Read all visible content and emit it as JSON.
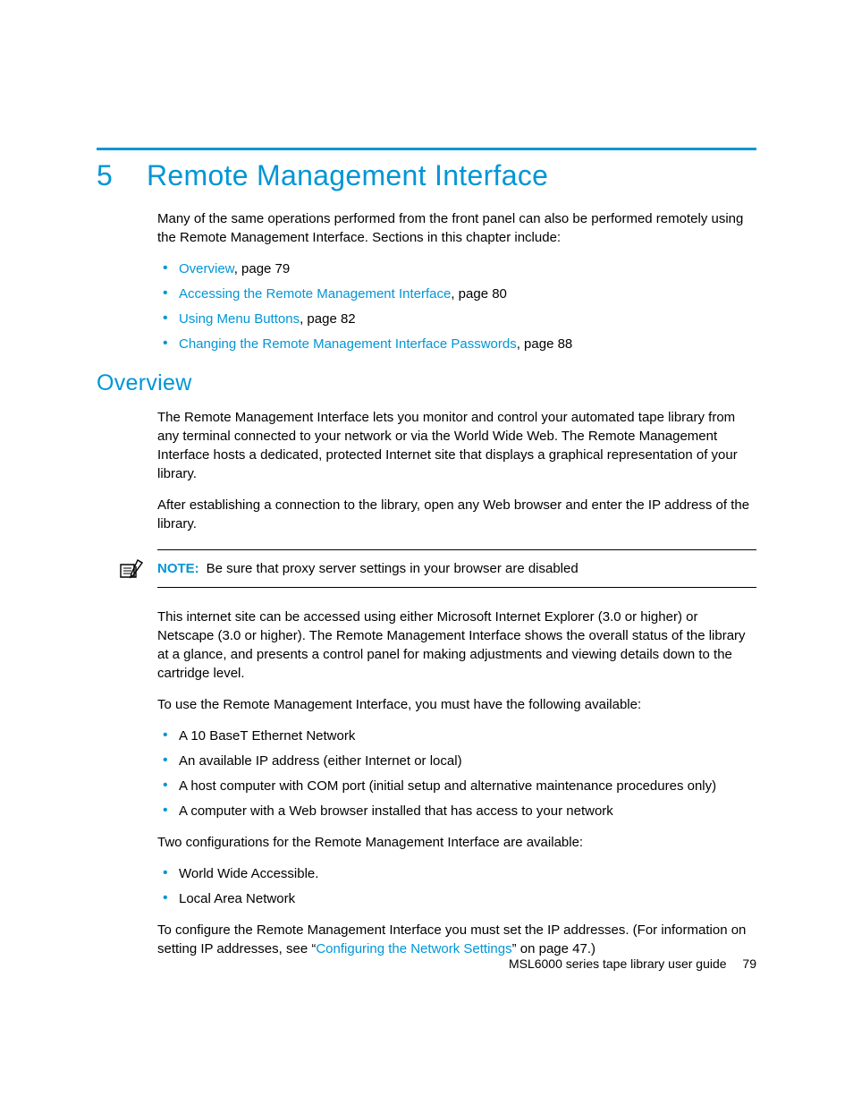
{
  "chapter": {
    "number": "5",
    "title": "Remote Management Interface"
  },
  "intro": "Many of the same operations performed from the front panel can also be performed remotely using the Remote Management Interface. Sections in this chapter include:",
  "toc": [
    {
      "link": "Overview",
      "suffix": ", page 79"
    },
    {
      "link": "Accessing the Remote Management Interface",
      "suffix": ", page 80"
    },
    {
      "link": "Using Menu Buttons",
      "suffix": ", page 82"
    },
    {
      "link": "Changing the Remote Management Interface Passwords",
      "suffix": ", page 88"
    }
  ],
  "section": {
    "heading": "Overview",
    "p1": "The Remote Management Interface lets you monitor and control your automated tape library from any terminal connected to your network or via the World Wide Web. The Remote Management Interface hosts a dedicated, protected Internet site that displays a graphical representation of your library.",
    "p2": "After establishing a connection to the library, open any Web browser and enter the IP address of the library.",
    "note_label": "NOTE:",
    "note_body": "Be sure that proxy server settings in your browser are disabled",
    "p3": "This internet site can be accessed using either Microsoft Internet Explorer (3.0 or higher) or Netscape (3.0 or higher). The Remote Management Interface shows the overall status of the library at a glance, and presents a control panel for making adjustments and viewing details down to the cartridge level.",
    "p4": "To use the Remote Management Interface, you must have the following available:",
    "requirements": [
      "A 10 BaseT Ethernet Network",
      "An available IP address (either Internet or local)",
      "A host computer with COM port (initial setup and alternative maintenance procedures only)",
      "A computer with a Web browser installed that has access to your network"
    ],
    "p5": "Two configurations for the Remote Management Interface are available:",
    "configs": [
      "World Wide Accessible.",
      "Local Area Network"
    ],
    "p6_pre": "To configure the Remote Management Interface you must set the IP addresses. (For information on setting IP addresses, see “",
    "p6_link": "Configuring the Network Settings",
    "p6_post": "” on page 47.)"
  },
  "footer": {
    "title": "MSL6000 series tape library user guide",
    "page": "79"
  }
}
